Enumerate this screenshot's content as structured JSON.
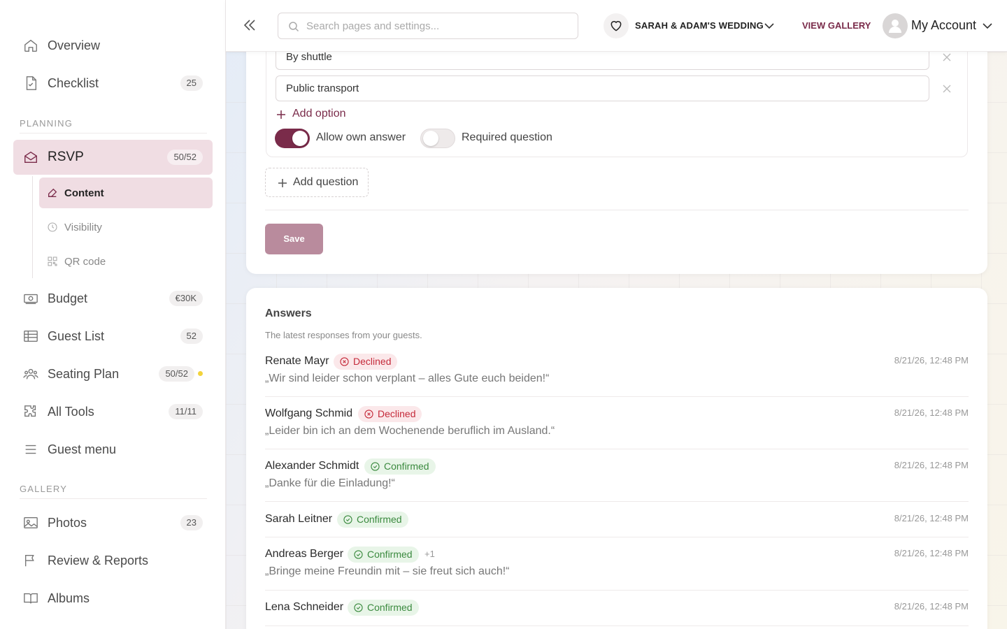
{
  "sidebar": {
    "items": [
      {
        "label": "Overview",
        "badge": null
      },
      {
        "label": "Checklist",
        "badge": "25"
      },
      {
        "label": "RSVP",
        "badge": "50/52"
      },
      {
        "label": "Budget",
        "badge": "€30K"
      },
      {
        "label": "Guest List",
        "badge": "52"
      },
      {
        "label": "Seating Plan",
        "badge": "50/52"
      },
      {
        "label": "All Tools",
        "badge": "11/11"
      },
      {
        "label": "Guest menu",
        "badge": null
      },
      {
        "label": "Photos",
        "badge": "23"
      },
      {
        "label": "Review & Reports",
        "badge": null
      },
      {
        "label": "Albums",
        "badge": null
      }
    ],
    "sections": {
      "planning": "PLANNING",
      "gallery": "GALLERY"
    },
    "rsvp_sub": [
      {
        "label": "Content"
      },
      {
        "label": "Visibility"
      },
      {
        "label": "QR code"
      }
    ],
    "accent": "#7a2b4a",
    "active_bg": "#f0dde3"
  },
  "topbar": {
    "search_placeholder": "Search pages and settings...",
    "wedding": "SARAH & ADAM'S WEDDING",
    "view_gallery": "VIEW GALLERY",
    "account": "My Account"
  },
  "editor": {
    "options": [
      "By shuttle",
      "Public transport"
    ],
    "add_option": "Add option",
    "allow_own_answer": "Allow own answer",
    "allow_own_answer_on": true,
    "required_question": "Required question",
    "required_question_on": false,
    "add_question": "Add question",
    "save": "Save"
  },
  "answers": {
    "title": "Answers",
    "subtitle": "The latest responses from your guests.",
    "items": [
      {
        "name": "Renate Mayr",
        "status": "Declined",
        "plus": null,
        "message": "„Wir sind leider schon verplant – alles Gute euch beiden!“",
        "time": "8/21/26, 12:48 PM"
      },
      {
        "name": "Wolfgang Schmid",
        "status": "Declined",
        "plus": null,
        "message": "„Leider bin ich an dem Wochenende beruflich im Ausland.“",
        "time": "8/21/26, 12:48 PM"
      },
      {
        "name": "Alexander Schmidt",
        "status": "Confirmed",
        "plus": null,
        "message": "„Danke für die Einladung!“",
        "time": "8/21/26, 12:48 PM"
      },
      {
        "name": "Sarah Leitner",
        "status": "Confirmed",
        "plus": null,
        "message": null,
        "time": "8/21/26, 12:48 PM"
      },
      {
        "name": "Andreas Berger",
        "status": "Confirmed",
        "plus": "+1",
        "message": "„Bringe meine Freundin mit – sie freut sich auch!“",
        "time": "8/21/26, 12:48 PM"
      },
      {
        "name": "Lena Schneider",
        "status": "Confirmed",
        "plus": null,
        "message": null,
        "time": "8/21/26, 12:48 PM"
      }
    ]
  }
}
